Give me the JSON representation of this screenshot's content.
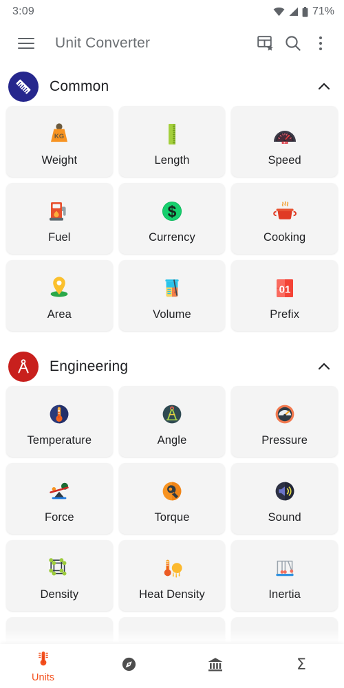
{
  "status_bar": {
    "time": "3:09",
    "battery": "71%",
    "icons": [
      "wifi-icon",
      "signal-icon",
      "battery-icon"
    ]
  },
  "toolbar": {
    "menu_icon": "hamburger-menu-icon",
    "title": "Unit Converter",
    "actions": [
      {
        "name": "favorite-table-icon",
        "label": "Favorites Table"
      },
      {
        "name": "search-icon",
        "label": "Search"
      },
      {
        "name": "overflow-menu-icon",
        "label": "More options"
      }
    ]
  },
  "sections": [
    {
      "id": "common",
      "title": "Common",
      "badge_icon": "ruler-icon",
      "badge_color": "#26278d",
      "expanded": true,
      "collapse_icon": "chevron-up-icon",
      "items": [
        {
          "label": "Weight",
          "icon": "weight-kg-icon"
        },
        {
          "label": "Length",
          "icon": "ruler-vertical-icon"
        },
        {
          "label": "Speed",
          "icon": "speedometer-icon"
        },
        {
          "label": "Fuel",
          "icon": "fuel-pump-icon"
        },
        {
          "label": "Currency",
          "icon": "dollar-coin-icon"
        },
        {
          "label": "Cooking",
          "icon": "cooking-pot-icon"
        },
        {
          "label": "Area",
          "icon": "map-pin-icon"
        },
        {
          "label": "Volume",
          "icon": "beaker-icon"
        },
        {
          "label": "Prefix",
          "icon": "flip-number-01-icon"
        }
      ]
    },
    {
      "id": "engineering",
      "title": "Engineering",
      "badge_icon": "compass-divider-icon",
      "badge_color": "#c8201d",
      "expanded": true,
      "collapse_icon": "chevron-up-icon",
      "items": [
        {
          "label": "Temperature",
          "icon": "thermometer-circle-icon"
        },
        {
          "label": "Angle",
          "icon": "protractor-compass-icon"
        },
        {
          "label": "Pressure",
          "icon": "pressure-gauge-icon"
        },
        {
          "label": "Force",
          "icon": "seesaw-balance-icon"
        },
        {
          "label": "Torque",
          "icon": "wrench-circle-icon"
        },
        {
          "label": "Sound",
          "icon": "speaker-sound-icon"
        },
        {
          "label": "Density",
          "icon": "cube-lattice-icon"
        },
        {
          "label": "Heat Density",
          "icon": "thermometer-sun-icon"
        },
        {
          "label": "Inertia",
          "icon": "newtons-cradle-icon"
        }
      ]
    }
  ],
  "bottom_nav": {
    "active_index": 0,
    "items": [
      {
        "label": "Units",
        "icon": "thermometer-icon",
        "active": true
      },
      {
        "label": "",
        "icon": "compass-icon",
        "active": false
      },
      {
        "label": "",
        "icon": "bank-icon",
        "active": false
      },
      {
        "label": "",
        "icon": "sigma-icon",
        "active": false
      }
    ]
  },
  "colors": {
    "accent": "#f4511e",
    "card_bg": "#f4f4f4",
    "text_primary": "#202124",
    "text_secondary": "#5f6368"
  }
}
